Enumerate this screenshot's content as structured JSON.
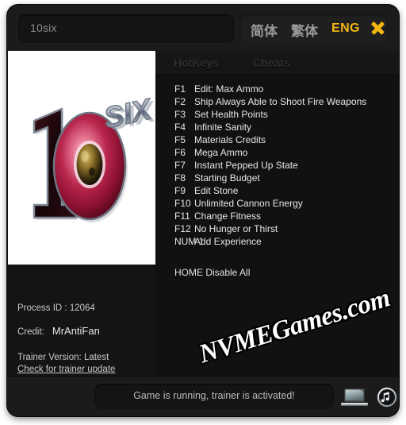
{
  "window": {
    "title_field_value": "10six"
  },
  "languages": {
    "simplified": "简体",
    "traditional": "繁体",
    "english": "ENG",
    "active": "ENG",
    "active_color": "#f2b512",
    "inactive_color": "#9a9a9a",
    "close_label": "✕"
  },
  "cover": {
    "game_title": "10six",
    "logo_digit_one": "1",
    "logo_digit_zero": "0",
    "logo_word": "SIX",
    "background_color": "#ffffff",
    "zero_color": "#b01a3e"
  },
  "tabs": [
    {
      "label": "HotKeys",
      "active": false
    },
    {
      "label": "Cheats",
      "active": false
    }
  ],
  "cheats": [
    {
      "key": "F1",
      "label": "Edit: Max Ammo"
    },
    {
      "key": "F2",
      "label": "Ship Always Able to Shoot Fire Weapons"
    },
    {
      "key": "F3",
      "label": "Set Health Points"
    },
    {
      "key": "F4",
      "label": "Infinite Sanity"
    },
    {
      "key": "F5",
      "label": "Materials Credits"
    },
    {
      "key": "F6",
      "label": "Mega Ammo"
    },
    {
      "key": "F7",
      "label": "Instant Pepped Up State"
    },
    {
      "key": "F8",
      "label": "Starting Budget"
    },
    {
      "key": "F9",
      "label": "Edit Stone"
    },
    {
      "key": "F10",
      "label": "Unlimited Cannon Energy"
    },
    {
      "key": "F11",
      "label": "Change Fitness"
    },
    {
      "key": "F12",
      "label": "No Hunger or Thirst"
    },
    {
      "key": "NUM 1",
      "label": "Add Experience"
    }
  ],
  "disable_all": "HOME Disable All",
  "info": {
    "process_id_label": "Process ID : 12064",
    "credit_label": "Credit:",
    "credit_name": "MrAntiFan",
    "trainer_version": "Trainer Version: Latest",
    "update_link": "Check for trainer update"
  },
  "status": {
    "message": "Game is running, trainer is activated!"
  },
  "bottom_icons": {
    "monitor": "monitor-icon",
    "music": "music-note-icon"
  },
  "watermark": {
    "text": "NVMEGames.com"
  }
}
